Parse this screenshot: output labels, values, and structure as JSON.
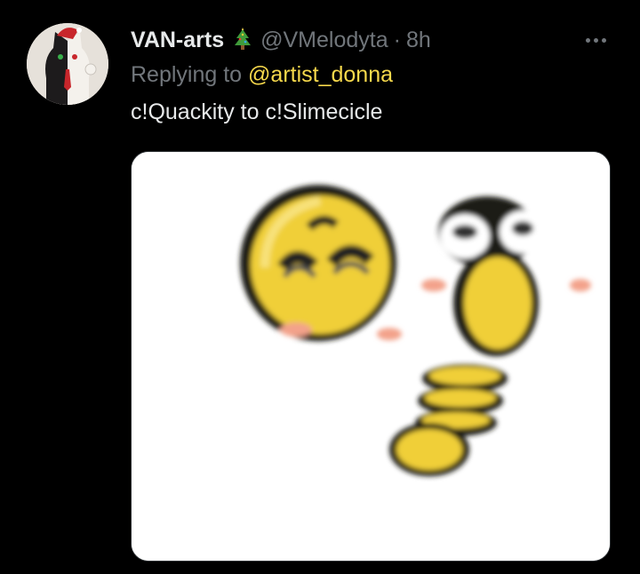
{
  "tweet": {
    "author": {
      "display_name": "VAN-arts",
      "emoji_icon": "christmas-tree-icon",
      "handle": "@VMelodyta",
      "separator": "·",
      "time": "8h"
    },
    "reply": {
      "prefix": "Replying to",
      "mention": "@artist_donna"
    },
    "text": "c!Quackity to c!Slimecicle",
    "more_icon": "more-options-icon"
  },
  "colors": {
    "background": "#000000",
    "text_primary": "#e7e9ea",
    "text_secondary": "#71767b",
    "mention": "#f7d94c"
  }
}
